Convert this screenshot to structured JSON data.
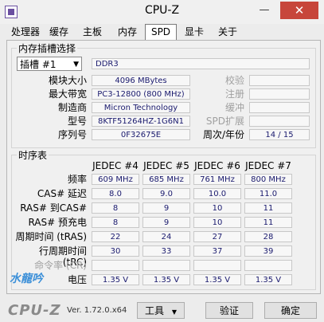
{
  "window": {
    "title": "CPU-Z",
    "minimize_label": "—",
    "close_label": "✕"
  },
  "tabs": [
    {
      "label": "处理器"
    },
    {
      "label": "缓存"
    },
    {
      "label": "主板"
    },
    {
      "label": "内存"
    },
    {
      "label": "SPD"
    },
    {
      "label": "显卡"
    },
    {
      "label": "关于"
    }
  ],
  "slot": {
    "group_title": "内存插槽选择",
    "selected_slot": "插槽 #1",
    "module_type": "DDR3",
    "labels": {
      "module_size": "模块大小",
      "max_bandwidth": "最大带宽",
      "manufacturer": "制造商",
      "part_number": "型号",
      "serial": "序列号"
    },
    "values": {
      "module_size": "4096 MBytes",
      "max_bandwidth": "PC3-12800 (800 MHz)",
      "manufacturer": "Micron Technology",
      "part_number": "8KTF51264HZ-1G6N1",
      "serial": "0F32675E"
    },
    "right_labels": {
      "correction": "校验",
      "registered": "注册",
      "buffered": "缓冲",
      "spd_ext": "SPD扩展",
      "week_year": "周次/年份"
    },
    "week_year": "14 / 15"
  },
  "timings": {
    "group_title": "时序表",
    "columns": [
      "JEDEC #4",
      "JEDEC #5",
      "JEDEC #6",
      "JEDEC #7"
    ],
    "rows": [
      {
        "label": "频率",
        "values": [
          "609 MHz",
          "685 MHz",
          "761 MHz",
          "800 MHz"
        ]
      },
      {
        "label": "CAS# 延迟",
        "values": [
          "8.0",
          "9.0",
          "10.0",
          "11.0"
        ]
      },
      {
        "label": "RAS# 到CAS#",
        "values": [
          "8",
          "9",
          "10",
          "11"
        ]
      },
      {
        "label": "RAS# 预充电",
        "values": [
          "8",
          "9",
          "10",
          "11"
        ]
      },
      {
        "label": "周期时间 (tRAS)",
        "values": [
          "22",
          "24",
          "27",
          "28"
        ]
      },
      {
        "label": "行周期时间 (tRC)",
        "values": [
          "30",
          "33",
          "37",
          "39"
        ]
      },
      {
        "label": "命令率 (CR)",
        "values": [
          "",
          "",
          "",
          ""
        ]
      },
      {
        "label": "电压",
        "values": [
          "1.35 V",
          "1.35 V",
          "1.35 V",
          "1.35 V"
        ]
      }
    ]
  },
  "watermark": "水龍吟",
  "footer": {
    "brand": "CPU-Z",
    "version": "Ver. 1.72.0.x64",
    "tools_label": "工具",
    "validate_label": "验证",
    "ok_label": "确定"
  }
}
